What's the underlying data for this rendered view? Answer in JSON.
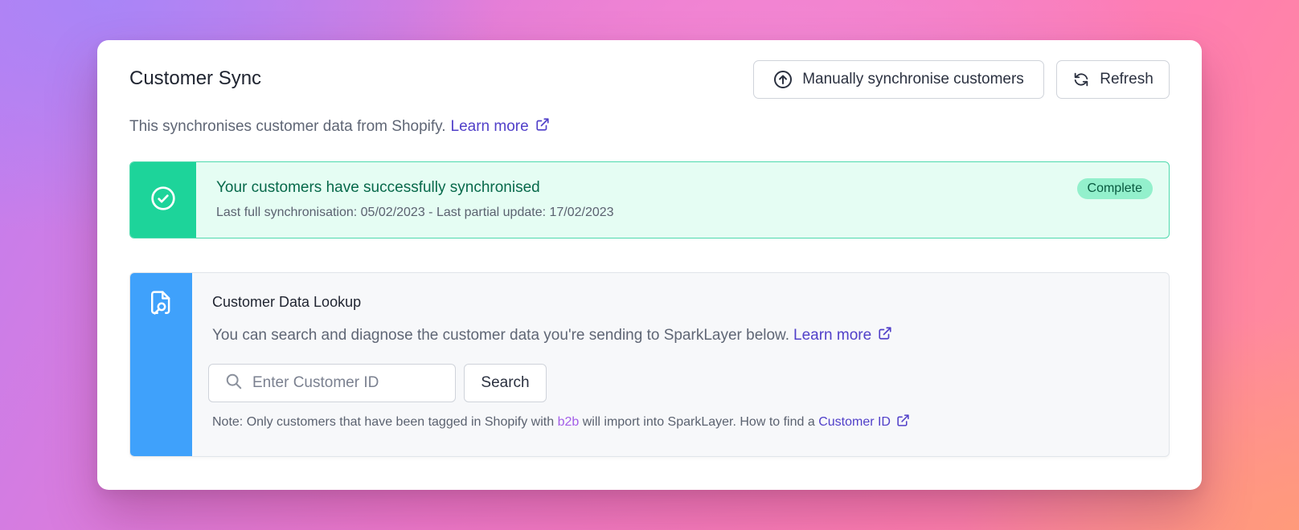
{
  "header": {
    "title": "Customer Sync",
    "sync_button": "Manually synchronise customers",
    "refresh_button": "Refresh"
  },
  "intro": {
    "text": "This synchronises customer data from Shopify.",
    "link": "Learn more"
  },
  "status": {
    "heading": "Your customers have successfully synchronised",
    "detail": "Last full synchronisation: 05/02/2023 - Last partial update: 17/02/2023",
    "badge": "Complete"
  },
  "lookup": {
    "heading": "Customer Data Lookup",
    "description": "You can search and diagnose the customer data you're sending to SparkLayer below.",
    "link": "Learn more",
    "search_placeholder": "Enter Customer ID",
    "search_value": "",
    "search_button": "Search",
    "note_prefix": "Note: Only customers that have been tagged in Shopify with ",
    "note_tag": "b2b",
    "note_suffix": " will import into SparkLayer. How to find a ",
    "note_link": "Customer ID"
  },
  "colors": {
    "accent_link": "#5140c9",
    "success_bar": "#1dd49a",
    "success_bg": "#e5fdf3",
    "badge_bg": "#93f0cc",
    "lookup_bar": "#3fa1fb",
    "tag_color": "#a35ee8"
  },
  "icons": {
    "sync": "upload-circle-icon",
    "refresh": "refresh-icon",
    "external": "external-link-icon",
    "success": "check-circle-icon",
    "lookup": "document-search-icon",
    "search": "search-icon"
  }
}
